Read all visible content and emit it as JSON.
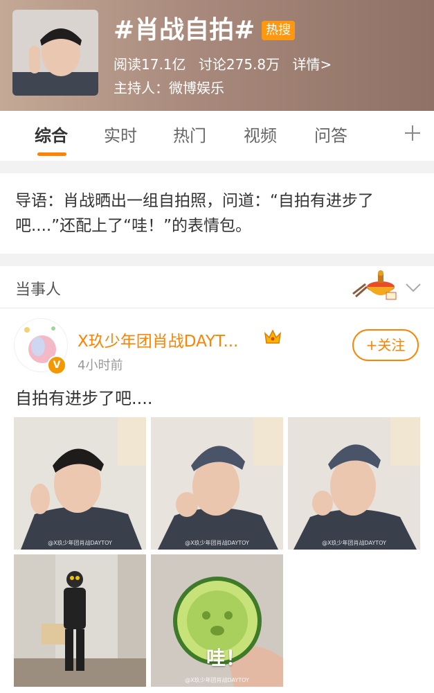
{
  "header": {
    "title": "#肖战自拍#",
    "badge": "热搜",
    "reads": "阅读17.1亿",
    "discussions": "讨论275.8万",
    "details_link": "详情>",
    "host": "主持人：微博娱乐"
  },
  "tabs": [
    {
      "label": "综合",
      "active": true
    },
    {
      "label": "实时"
    },
    {
      "label": "热门"
    },
    {
      "label": "视频"
    },
    {
      "label": "问答"
    }
  ],
  "intro": {
    "text": "导语：肖战晒出一组自拍照，问道：“自拍有进步了吧....”还配上了“哇！”的表情包。"
  },
  "party": {
    "label": "当事人"
  },
  "post": {
    "username": "X玖少年团肖战DAYT...",
    "time": "4小时前",
    "follow_label": "+关注",
    "content": "自拍有进步了吧....",
    "watermark": "@X玖少年团肖战DAYTOY",
    "emoji_caption": "哇！"
  },
  "colors": {
    "accent": "#ff8200",
    "hot_badge": "#ff9811"
  }
}
